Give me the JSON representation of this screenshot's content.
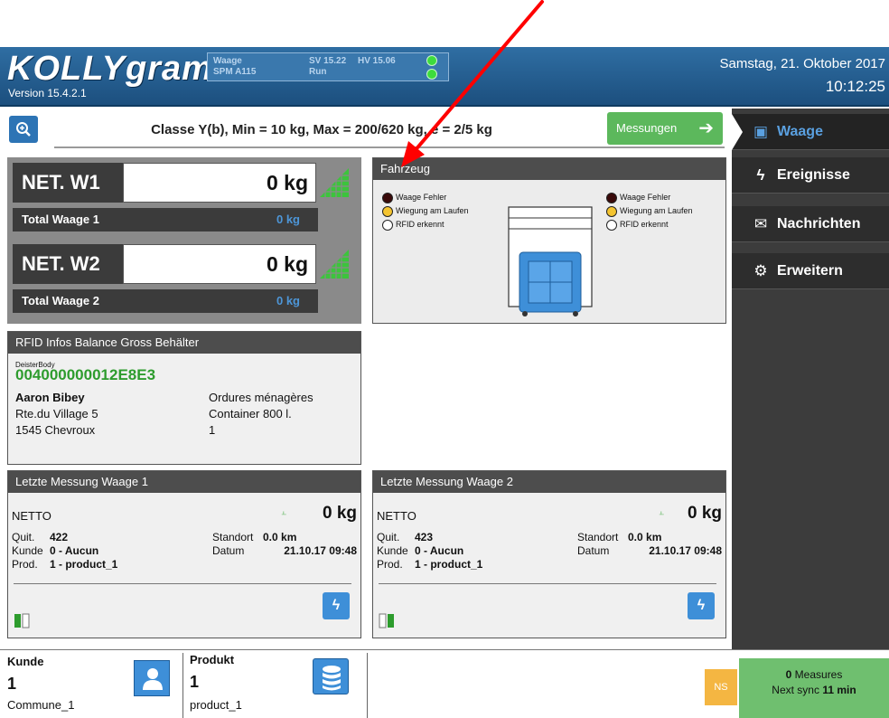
{
  "header": {
    "logo": "KOLLYgram",
    "version": "Version 15.4.2.1",
    "device_name": "Waage",
    "device_model": "SPM A115",
    "sv_label": "SV 15.22",
    "hv_label": "HV 15.06",
    "run_label": "Run",
    "date": "Samstag, 21. Oktober 2017",
    "time": "10:12:25"
  },
  "classe": {
    "text": "Classe Y(b), Min = 10 kg, Max = 200/620 kg, e = 2/5 kg",
    "messungen_label": "Messungen"
  },
  "sidebar": {
    "items": [
      {
        "label": "Waage",
        "icon": "scale-icon"
      },
      {
        "label": "Ereignisse",
        "icon": "lightning-icon"
      },
      {
        "label": "Nachrichten",
        "icon": "envelope-icon"
      },
      {
        "label": "Erweitern",
        "icon": "gears-icon"
      }
    ]
  },
  "scales": {
    "w1_label": "NET. W1",
    "w1_value": "0 kg",
    "total1_label": "Total Waage 1",
    "total1_value": "0 kg",
    "w2_label": "NET. W2",
    "w2_value": "0 kg",
    "total2_label": "Total Waage 2",
    "total2_value": "0 kg"
  },
  "fahrzeug": {
    "title": "Fahrzeug",
    "left": [
      "Waage Fehler",
      "Wiegung am Laufen",
      "RFID erkennt"
    ],
    "right": [
      "Waage Fehler",
      "Wiegung am Laufen",
      "RFID erkennt"
    ]
  },
  "rfid": {
    "title": "RFID Infos Balance Gross Behälter",
    "reader": "DeisterBody",
    "code": "004000000012E8E3",
    "name": "Aaron Bibey",
    "street": "Rte.du Village 5",
    "city": "1545 Chevroux",
    "type": "Ordures ménagères",
    "container": "Container 800 l.",
    "count": "1"
  },
  "last1": {
    "title": "Letzte Messung Waage 1",
    "netto": "NETTO",
    "value": "0 kg",
    "quit_label": "Quit.",
    "quit": "422",
    "kunde_label": "Kunde",
    "kunde": "0 - Aucun",
    "prod_label": "Prod.",
    "prod": "1 - product_1",
    "standort_label": "Standort",
    "standort": "0.0 km",
    "datum_label": "Datum",
    "datum": "21.10.17 09:48"
  },
  "last2": {
    "title": "Letzte Messung Waage 2",
    "netto": "NETTO",
    "value": "0 kg",
    "quit_label": "Quit.",
    "quit": "423",
    "kunde_label": "Kunde",
    "kunde": "0 - Aucun",
    "prod_label": "Prod.",
    "prod": "1 - product_1",
    "standort_label": "Standort",
    "standort": "0.0 km",
    "datum_label": "Datum",
    "datum": "21.10.17 09:48"
  },
  "footer": {
    "kunde_label": "Kunde",
    "kunde_value": "1",
    "kunde_name": "Commune_1",
    "produkt_label": "Produkt",
    "produkt_value": "1",
    "produkt_name": "product_1",
    "ns_label": "NS",
    "measures_count": "0",
    "measures_label": "Measures",
    "sync_label": "Next sync",
    "sync_value": "11 min"
  },
  "colors": {
    "header": "#1c4f7e",
    "accent_green": "#5cb85c",
    "sidebar": "#3c3c3c",
    "annotation_arrow": "#ff0000"
  }
}
